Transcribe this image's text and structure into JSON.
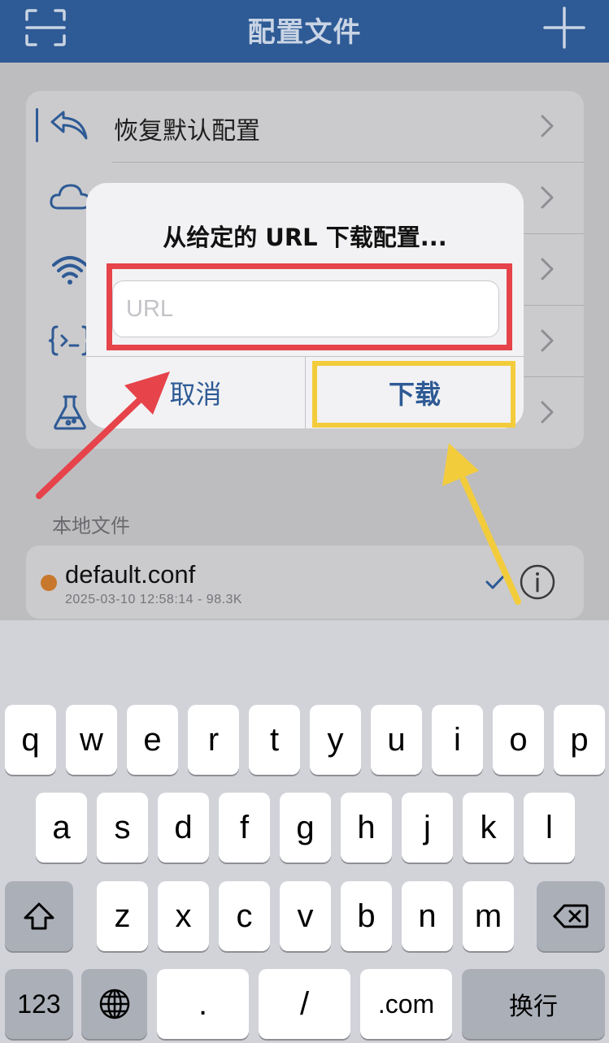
{
  "navbar": {
    "title": "配置文件",
    "left_icon": "scan-icon",
    "right_icon": "plus-icon"
  },
  "settings": {
    "rows": [
      {
        "label": "恢复默认配置",
        "icon": "undo-arrow-icon"
      },
      {
        "label": "",
        "icon": "cloud-icon"
      },
      {
        "label": "",
        "icon": "wifi-icon"
      },
      {
        "label": "",
        "icon": "script-braces-icon"
      },
      {
        "label": "",
        "icon": "flask-icon"
      }
    ]
  },
  "local_files": {
    "section_title": "本地文件",
    "items": [
      {
        "name": "default.conf",
        "meta": "2025-03-10 12:58:14 - 98.3K",
        "status_color": "#c8782c",
        "selected": true
      }
    ]
  },
  "alert": {
    "title": "从给定的 URL 下载配置...",
    "input_value": "",
    "input_placeholder": "URL",
    "cancel_label": "取消",
    "download_label": "下载"
  },
  "annotations": {
    "input_highlight_color": "#e6434a",
    "button_highlight_color": "#f3cc3c"
  },
  "keyboard": {
    "row1": [
      "q",
      "w",
      "e",
      "r",
      "t",
      "y",
      "u",
      "i",
      "o",
      "p"
    ],
    "row2": [
      "a",
      "s",
      "d",
      "f",
      "g",
      "h",
      "j",
      "k",
      "l"
    ],
    "row3": [
      "z",
      "x",
      "c",
      "v",
      "b",
      "n",
      "m"
    ],
    "numbers_key": "123",
    "slash_key": "/",
    "dot_key": ".",
    "dotcom_key": ".com",
    "return_key": "换行",
    "shift_icon": "shift-icon",
    "delete_icon": "delete-backspace-icon",
    "globe_icon": "globe-icon"
  }
}
